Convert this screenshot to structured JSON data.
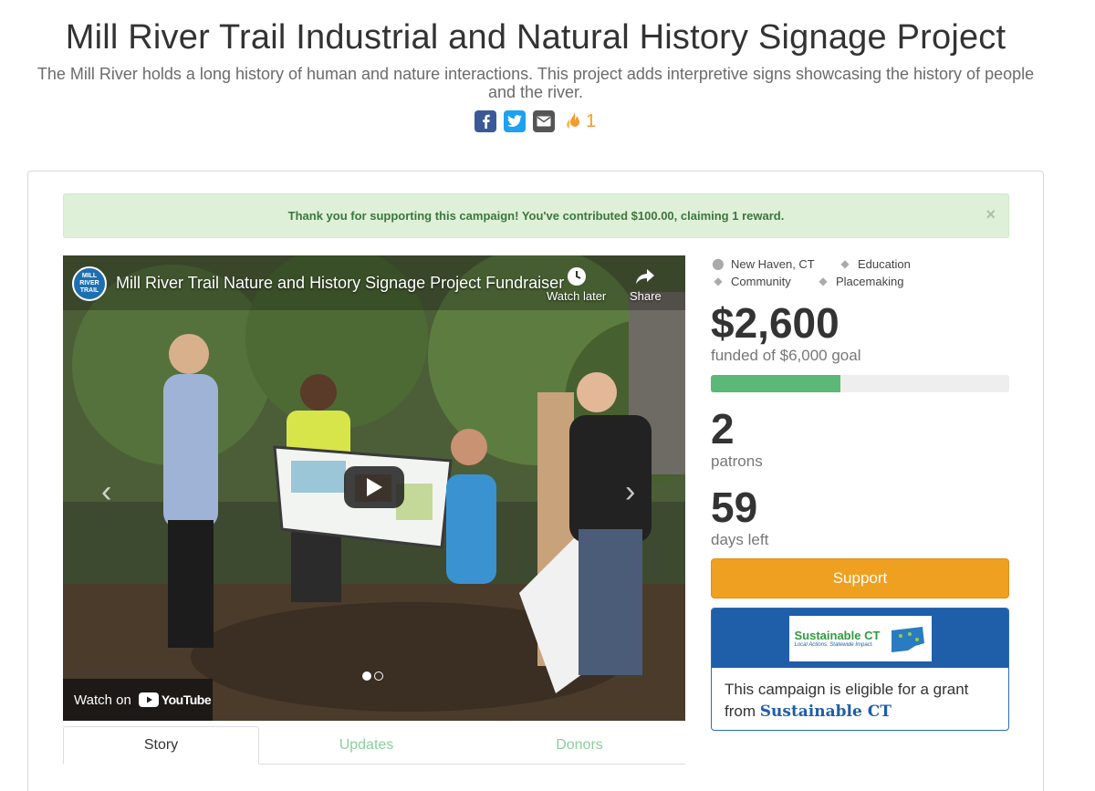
{
  "header": {
    "title": "Mill River Trail Industrial and Natural History Signage Project",
    "subtitle": "The Mill River holds a long history of human and nature interactions. This project adds interpretive signs showcasing the history of people and the river.",
    "flame_count": "1"
  },
  "alert": {
    "message": "Thank you for supporting this campaign! You've contributed $100.00, claiming 1 reward.",
    "close": "×"
  },
  "video": {
    "channel_logo_text": "MILL RIVER TRAIL",
    "title": "Mill River Trail Nature and History Signage Project Fundraiser",
    "watch_later": "Watch later",
    "share": "Share",
    "watch_on": "Watch on",
    "youtube": "YouTube"
  },
  "tabs": [
    "Story",
    "Updates",
    "Donors"
  ],
  "tags": {
    "location": "New Haven, CT",
    "categories": [
      "Education",
      "Community",
      "Placemaking"
    ]
  },
  "stats": {
    "funded_amount": "$2,600",
    "funded_label": "funded of $6,000 goal",
    "progress_percent": 43.3,
    "patrons_count": "2",
    "patrons_label": "patrons",
    "days_count": "59",
    "days_label": "days left"
  },
  "support_label": "Support",
  "grant": {
    "logo_title": "Sustainable CT",
    "logo_tagline": "Local Actions. Statewide Impact.",
    "text": "This campaign is eligible for a grant from",
    "link": "Sustainable CT"
  },
  "colors": {
    "accent_orange": "#f0a020",
    "progress_green": "#5cb877",
    "alert_green": "#3c763d",
    "grant_blue": "#1f5ea8"
  }
}
